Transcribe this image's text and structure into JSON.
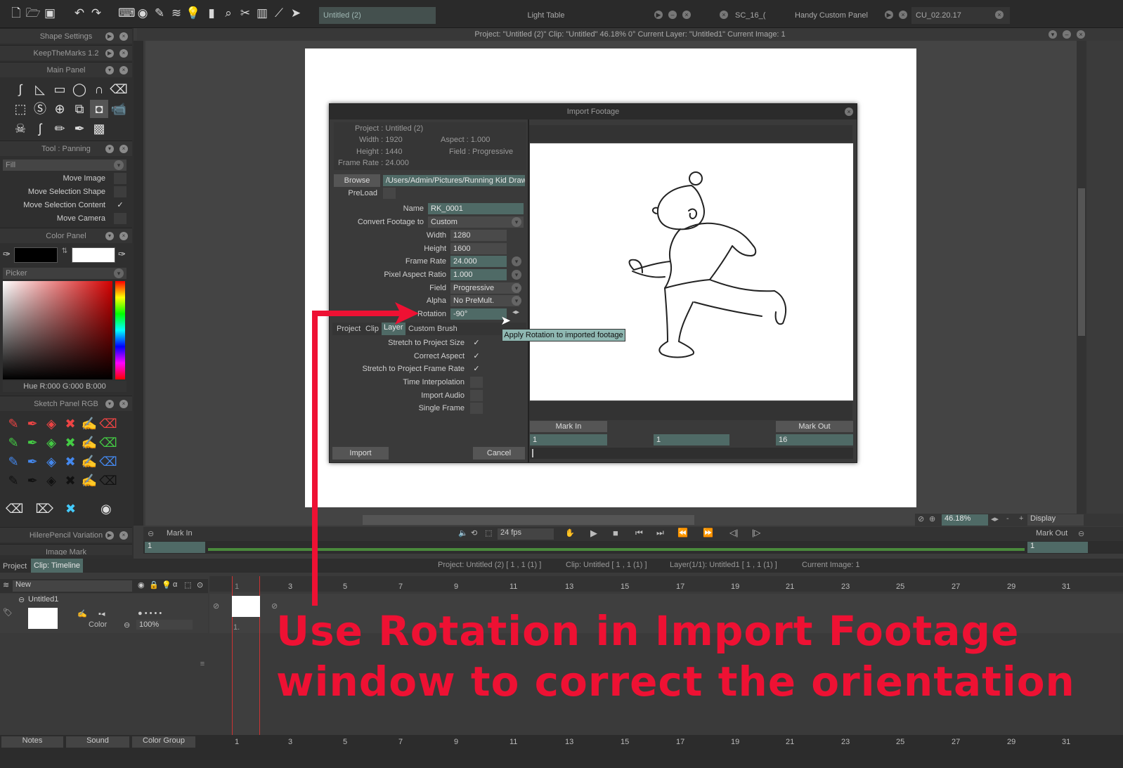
{
  "topbar": {
    "tabs": [
      {
        "label": "Untitled (2)"
      },
      {
        "label": "Light Table"
      },
      {
        "label": "SC_16_("
      },
      {
        "label": "Handy Custom Panel"
      },
      {
        "label": "CU_02.20.17"
      }
    ]
  },
  "statusbar": "Project:  \"Untitled (2)\"  Clip: \"Untitled\"   46.18%   0°  Current Layer: \"Untitled1\"  Current Image: 1",
  "left_panels": {
    "shape_settings": "Shape Settings",
    "keepthemarks": "KeepTheMarks 1.2",
    "main_panel": "Main Panel",
    "tool_panning": "Tool : Panning",
    "fill_dropdown": "Fill",
    "options": [
      {
        "label": "Move Image",
        "checked": ""
      },
      {
        "label": "Move Selection Shape",
        "checked": ""
      },
      {
        "label": "Move Selection Content",
        "checked": "✓"
      },
      {
        "label": "Move Camera",
        "checked": ""
      }
    ],
    "color_panel": "Color Panel",
    "picker": "Picker",
    "hue_readout": "Hue R:000 G:000 B:000",
    "sketch_panel": "Sketch Panel RGB",
    "hilere": "HilerePencil Variation",
    "image_mark": "Image Mark"
  },
  "dialog": {
    "title": "Import Footage",
    "info": {
      "project": "Project : Untitled (2)",
      "width": "Width : 1920",
      "aspect": "Aspect : 1.000",
      "height": "Height : 1440",
      "field": "Field : Progressive",
      "frame_rate": "Frame Rate : 24.000"
    },
    "browse_label": "Browse",
    "path": "/Users/Admin/Pictures/Running Kid Draw",
    "preload_label": "PreLoad",
    "name_label": "Name",
    "name_value": "RK_0001",
    "convert_label": "Convert Footage to",
    "convert_value": "Custom",
    "width_label": "Width",
    "width_value": "1280",
    "height_label": "Height",
    "height_value": "1600",
    "framerate_label": "Frame Rate",
    "framerate_value": "24.000",
    "par_label": "Pixel Aspect Ratio",
    "par_value": "1.000",
    "field_label": "Field",
    "field_value": "Progressive",
    "alpha_label": "Alpha",
    "alpha_value": "No PreMult.",
    "rotation_label": "Rotation",
    "rotation_value": "-90°",
    "tooltip": "Apply Rotation to imported footage",
    "tabs": [
      "Project",
      "Clip",
      "Layer",
      "Custom Brush"
    ],
    "options": [
      {
        "label": "Stretch to Project Size",
        "checked": "✓"
      },
      {
        "label": "Correct Aspect",
        "checked": "✓"
      },
      {
        "label": "Stretch to Project Frame Rate",
        "checked": "✓"
      },
      {
        "label": "Time Interpolation",
        "checked": ""
      },
      {
        "label": "Import Audio",
        "checked": ""
      },
      {
        "label": "Single Frame",
        "checked": ""
      }
    ],
    "mark_in": "Mark In",
    "mark_out": "Mark Out",
    "mark_in_value": "1",
    "mid_value": "1",
    "mark_out_value": "16",
    "import_btn": "Import",
    "cancel_btn": "Cancel"
  },
  "viewer": {
    "zoom": "46.18%",
    "display": "Display",
    "mark_in": "Mark In",
    "mark_out": "Mark Out",
    "fps": "24 fps",
    "frame_left": "1",
    "frame_right": "1"
  },
  "timeline": {
    "project_tab": "Project",
    "clip_tab": "Clip: Timeline",
    "info_project": "Project: Untitled (2) [ 1 , 1  (1) ]",
    "info_clip": "Clip: Untitled [ 1 , 1  (1) ]",
    "info_layer": "Layer(1/1): Untitled1 [ 1 , 1  (1) ]",
    "info_image": "Current Image: 1",
    "new_label": "New",
    "layer_name": "Untitled1",
    "color_label": "Color",
    "opacity": "100%",
    "frame_numbers": [
      "1",
      "3",
      "5",
      "7",
      "9",
      "11",
      "13",
      "15",
      "17",
      "19",
      "21",
      "23",
      "25",
      "27",
      "29",
      "31"
    ],
    "cell_label": "1.",
    "bottom_tabs": [
      "Notes",
      "Sound",
      "Color Group"
    ]
  },
  "annotation": {
    "line1": "Use Rotation in Import Footage",
    "line2": "window to correct the orientation"
  }
}
